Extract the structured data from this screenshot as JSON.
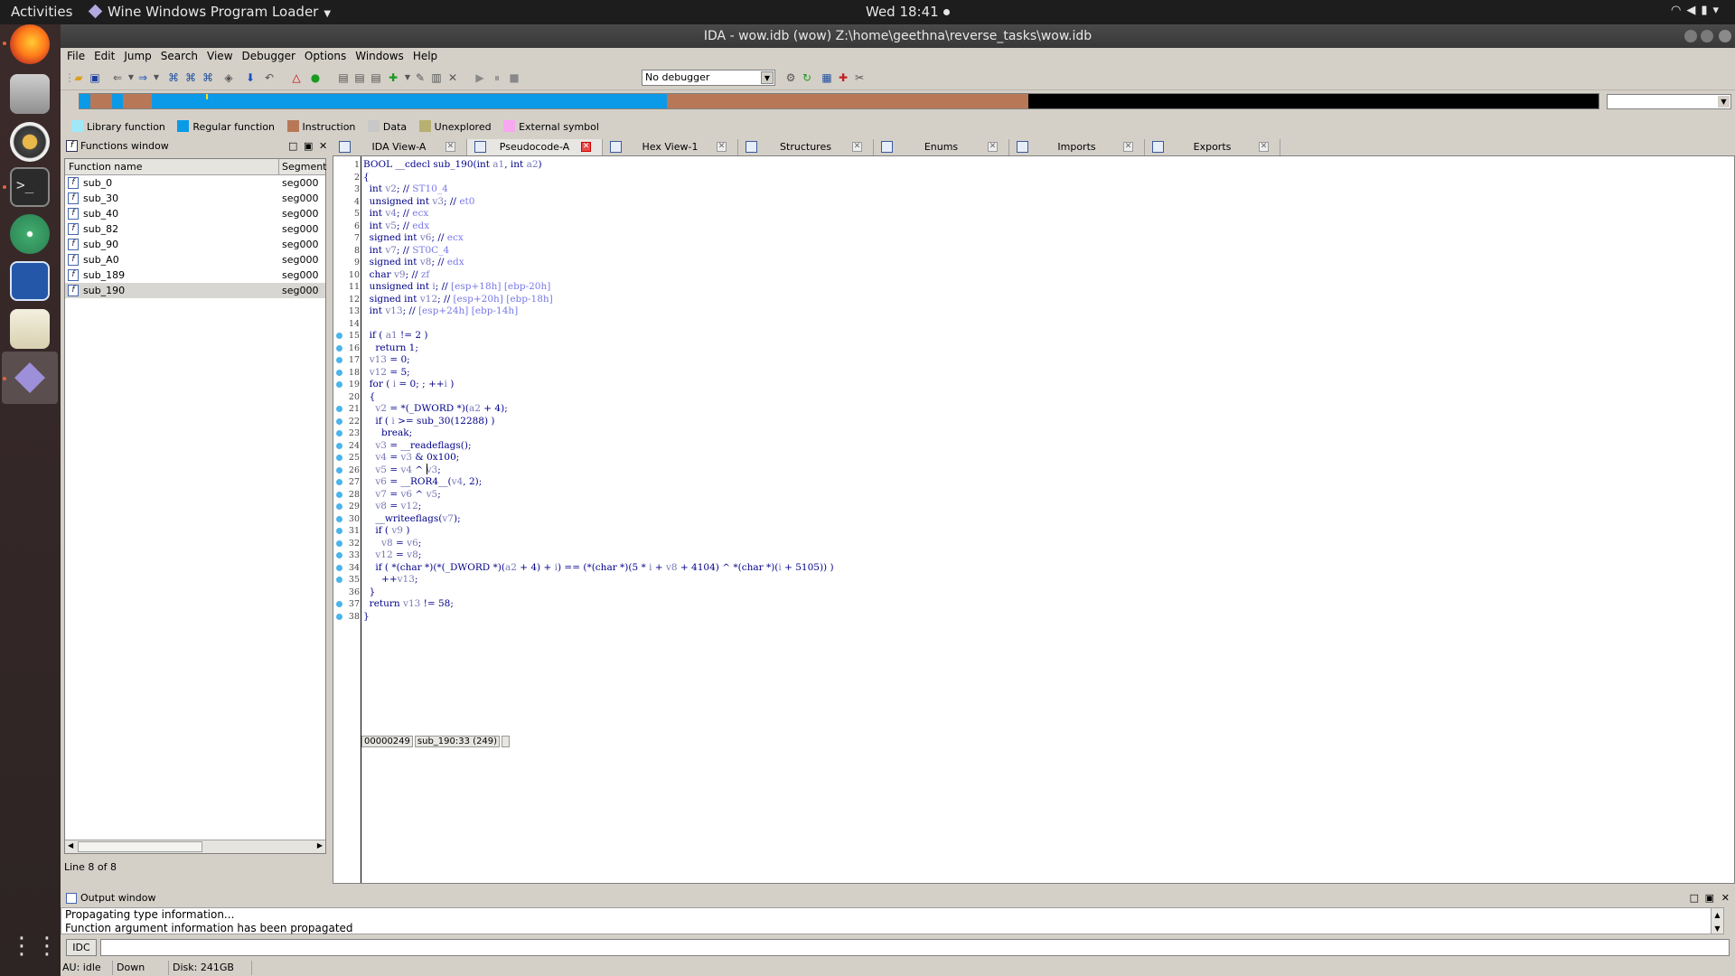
{
  "topbar": {
    "activities": "Activities",
    "app_name": "Wine Windows Program Loader",
    "clock": "Wed 18:41"
  },
  "window": {
    "title": "IDA - wow.idb (wow) Z:\\home\\geethna\\reverse_tasks\\wow.idb"
  },
  "menu": [
    "File",
    "Edit",
    "Jump",
    "Search",
    "View",
    "Debugger",
    "Options",
    "Windows",
    "Help"
  ],
  "toolbar": {
    "debugger_select": "No debugger"
  },
  "legend": [
    {
      "label": "Library function",
      "color": "#9ee8f8"
    },
    {
      "label": "Regular function",
      "color": "#0a9ae8"
    },
    {
      "label": "Instruction",
      "color": "#b87858"
    },
    {
      "label": "Data",
      "color": "#c8c8c8"
    },
    {
      "label": "Unexplored",
      "color": "#b8b070"
    },
    {
      "label": "External symbol",
      "color": "#f8a8f0"
    }
  ],
  "functions_window": {
    "title": "Functions window",
    "col_name": "Function name",
    "col_segment": "Segment",
    "rows": [
      {
        "name": "sub_0",
        "segment": "seg000"
      },
      {
        "name": "sub_30",
        "segment": "seg000"
      },
      {
        "name": "sub_40",
        "segment": "seg000"
      },
      {
        "name": "sub_82",
        "segment": "seg000"
      },
      {
        "name": "sub_90",
        "segment": "seg000"
      },
      {
        "name": "sub_A0",
        "segment": "seg000"
      },
      {
        "name": "sub_189",
        "segment": "seg000"
      },
      {
        "name": "sub_190",
        "segment": "seg000"
      }
    ],
    "selected_index": 7,
    "status": "Line 8 of 8"
  },
  "tabs": [
    {
      "label": "IDA View-A",
      "active": false
    },
    {
      "label": "Pseudocode-A",
      "active": true
    },
    {
      "label": "Hex View-1",
      "active": false
    },
    {
      "label": "Structures",
      "active": false
    },
    {
      "label": "Enums",
      "active": false
    },
    {
      "label": "Imports",
      "active": false
    },
    {
      "label": "Exports",
      "active": false
    }
  ],
  "pseudocode": [
    {
      "n": "1",
      "bp": false,
      "t": "BOOL __cdecl sub_190(int a1, int a2)"
    },
    {
      "n": "2",
      "bp": false,
      "t": "{"
    },
    {
      "n": "3",
      "bp": false,
      "t": "  int v2; // ST10_4"
    },
    {
      "n": "4",
      "bp": false,
      "t": "  unsigned int v3; // et0"
    },
    {
      "n": "5",
      "bp": false,
      "t": "  int v4; // ecx"
    },
    {
      "n": "6",
      "bp": false,
      "t": "  int v5; // edx"
    },
    {
      "n": "7",
      "bp": false,
      "t": "  signed int v6; // ecx"
    },
    {
      "n": "8",
      "bp": false,
      "t": "  int v7; // ST0C_4"
    },
    {
      "n": "9",
      "bp": false,
      "t": "  signed int v8; // edx"
    },
    {
      "n": "10",
      "bp": false,
      "t": "  char v9; // zf"
    },
    {
      "n": "11",
      "bp": false,
      "t": "  unsigned int i; // [esp+18h] [ebp-20h]"
    },
    {
      "n": "12",
      "bp": false,
      "t": "  signed int v12; // [esp+20h] [ebp-18h]"
    },
    {
      "n": "13",
      "bp": false,
      "t": "  int v13; // [esp+24h] [ebp-14h]"
    },
    {
      "n": "14",
      "bp": false,
      "t": ""
    },
    {
      "n": "15",
      "bp": true,
      "t": "  if ( a1 != 2 )"
    },
    {
      "n": "16",
      "bp": true,
      "t": "    return 1;"
    },
    {
      "n": "17",
      "bp": true,
      "t": "  v13 = 0;"
    },
    {
      "n": "18",
      "bp": true,
      "t": "  v12 = 5;"
    },
    {
      "n": "19",
      "bp": true,
      "t": "  for ( i = 0; ; ++i )"
    },
    {
      "n": "20",
      "bp": false,
      "t": "  {"
    },
    {
      "n": "21",
      "bp": true,
      "t": "    v2 = *(_DWORD *)(a2 + 4);"
    },
    {
      "n": "22",
      "bp": true,
      "t": "    if ( i >= sub_30(12288) )"
    },
    {
      "n": "23",
      "bp": true,
      "t": "      break;"
    },
    {
      "n": "24",
      "bp": true,
      "t": "    v3 = __readeflags();"
    },
    {
      "n": "25",
      "bp": true,
      "t": "    v4 = v3 & 0x100;"
    },
    {
      "n": "26",
      "bp": true,
      "t": "    v5 = v4 ^ v3;"
    },
    {
      "n": "27",
      "bp": true,
      "t": "    v6 = __ROR4__(v4, 2);"
    },
    {
      "n": "28",
      "bp": true,
      "t": "    v7 = v6 ^ v5;"
    },
    {
      "n": "29",
      "bp": true,
      "t": "    v8 = v12;"
    },
    {
      "n": "30",
      "bp": true,
      "t": "    __writeeflags(v7);"
    },
    {
      "n": "31",
      "bp": true,
      "t": "    if ( v9 )"
    },
    {
      "n": "32",
      "bp": true,
      "t": "      v8 = v6;"
    },
    {
      "n": "33",
      "bp": true,
      "t": "    v12 = v8;"
    },
    {
      "n": "34",
      "bp": true,
      "t": "    if ( *(char *)(*(_DWORD *)(a2 + 4) + i) == (*(char *)(5 * i + v8 + 4104) ^ *(char *)(i + 5105)) )"
    },
    {
      "n": "35",
      "bp": true,
      "t": "      ++v13;"
    },
    {
      "n": "36",
      "bp": false,
      "t": "  }"
    },
    {
      "n": "37",
      "bp": true,
      "t": "  return v13 != 58;"
    },
    {
      "n": "38",
      "bp": true,
      "t": "}"
    }
  ],
  "code_status": {
    "address": "00000249",
    "location": "sub_190:33 (249)"
  },
  "output_window": {
    "title": "Output window",
    "lines": [
      "Propagating type information...",
      "Function argument information has been propagated"
    ],
    "idc_button": "IDC"
  },
  "statusbar": {
    "au": "AU:  idle",
    "direction": "Down",
    "disk": "Disk: 241GB"
  }
}
